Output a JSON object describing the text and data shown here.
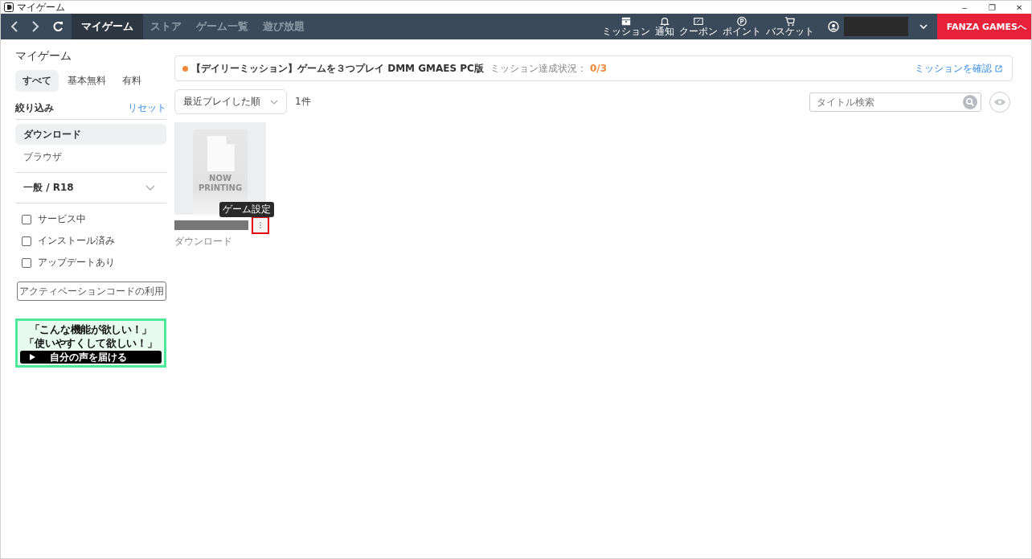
{
  "window": {
    "title": "マイゲーム",
    "controls": [
      "–",
      "❐",
      "✕"
    ]
  },
  "nav": {
    "tabs": [
      {
        "label": "マイゲーム",
        "selected": true
      },
      {
        "label": "ストア",
        "selected": false
      },
      {
        "label": "ゲーム一覧",
        "selected": false
      },
      {
        "label": "遊び放題",
        "selected": false
      }
    ],
    "tools": [
      {
        "kind": "mission",
        "label": "ミッション"
      },
      {
        "kind": "bell",
        "label": "通知"
      },
      {
        "kind": "coupon",
        "label": "クーポン"
      },
      {
        "kind": "point",
        "label": "ポイント"
      },
      {
        "kind": "cart",
        "label": "バスケット"
      }
    ],
    "external_button": "FANZA GAMESへ"
  },
  "sidebar": {
    "title": "マイゲーム",
    "price_tabs": [
      {
        "label": "すべて",
        "selected": true
      },
      {
        "label": "基本無料",
        "selected": false
      },
      {
        "label": "有料",
        "selected": false
      }
    ],
    "filter_label": "絞り込み",
    "reset": "リセット",
    "platforms": [
      {
        "label": "ダウンロード",
        "selected": true
      },
      {
        "label": "ブラウザ",
        "selected": false
      }
    ],
    "rating": "一般 / R18",
    "checks": [
      {
        "label": "サービス中",
        "checked": false
      },
      {
        "label": "インストール済み",
        "checked": false
      },
      {
        "label": "アップデートあり",
        "checked": false
      }
    ],
    "activation_button": "アクティベーションコードの利用",
    "banner": {
      "lines": [
        "「こんな機能が欲しい！」",
        "「使いやすくして欲しい！」"
      ],
      "button": "自分の声を届ける"
    }
  },
  "mission": {
    "text": "【デイリーミッション】ゲームを３つプレイ DMM GMAES PC版",
    "status_label": "ミッション達成状況：",
    "status": "0/3",
    "link": "ミッションを確認"
  },
  "toolbar": {
    "sort": "最近プレイした順",
    "count": "1件",
    "search": {
      "placeholder": "タイトル検索"
    }
  },
  "games": [
    {
      "cover_text": [
        "NOW",
        "PRINTING"
      ],
      "platform": "ダウンロード",
      "tooltip": "ゲーム設定",
      "highlighted": true
    }
  ]
}
